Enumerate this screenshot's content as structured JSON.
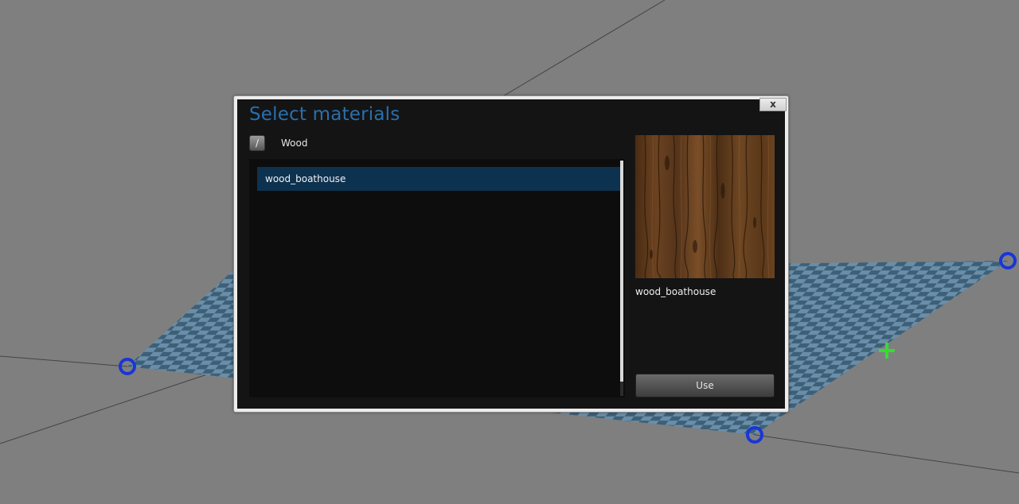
{
  "dialog": {
    "title": "Select materials",
    "close_label": "x",
    "root_button_label": "/",
    "current_path": "Wood",
    "materials": [
      "wood_boathouse"
    ],
    "selected_index": 0,
    "preview_name": "wood_boathouse",
    "use_label": "Use"
  },
  "colors": {
    "viewport_background": "#7f7f7f",
    "title_color": "#2a6fac",
    "selected_row": "#0d3250",
    "grid_plane_light": "#6a8ea8",
    "grid_plane_dark": "#3d5f78",
    "vertex_handle": "#1a35d8",
    "center_handle": "#33dd33"
  },
  "icons": {
    "vertex_handle": "circle-handle-icon",
    "center_handle": "plus-handle-icon"
  }
}
